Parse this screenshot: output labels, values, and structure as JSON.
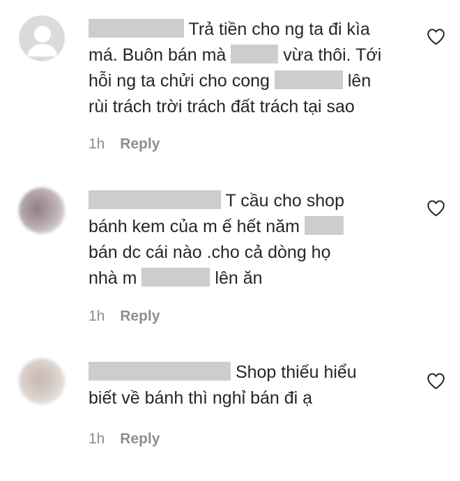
{
  "comments": [
    {
      "lines": [
        [
          "Trả tiền cho ng ta đi kìa"
        ],
        [
          "má. Buôn bán mà",
          "vừa thôi. Tới"
        ],
        [
          "hỗi ng ta chửi cho cong",
          "lên"
        ],
        [
          "rùi trách trời trách đất trách tại sao"
        ]
      ],
      "time": "1h",
      "reply": "Reply"
    },
    {
      "lines": [
        [
          "T cầu cho shop"
        ],
        [
          "bánh kem của m ế hết năm"
        ],
        [
          "bán dc cái nào .cho cả dòng họ"
        ],
        [
          "nhà m",
          "lên ăn"
        ]
      ],
      "time": "1h",
      "reply": "Reply"
    },
    {
      "lines": [
        [
          "Shop thiếu hiểu"
        ],
        [
          "biết về bánh thì nghỉ bán đi ạ"
        ]
      ],
      "time": "1h",
      "reply": "Reply"
    }
  ]
}
